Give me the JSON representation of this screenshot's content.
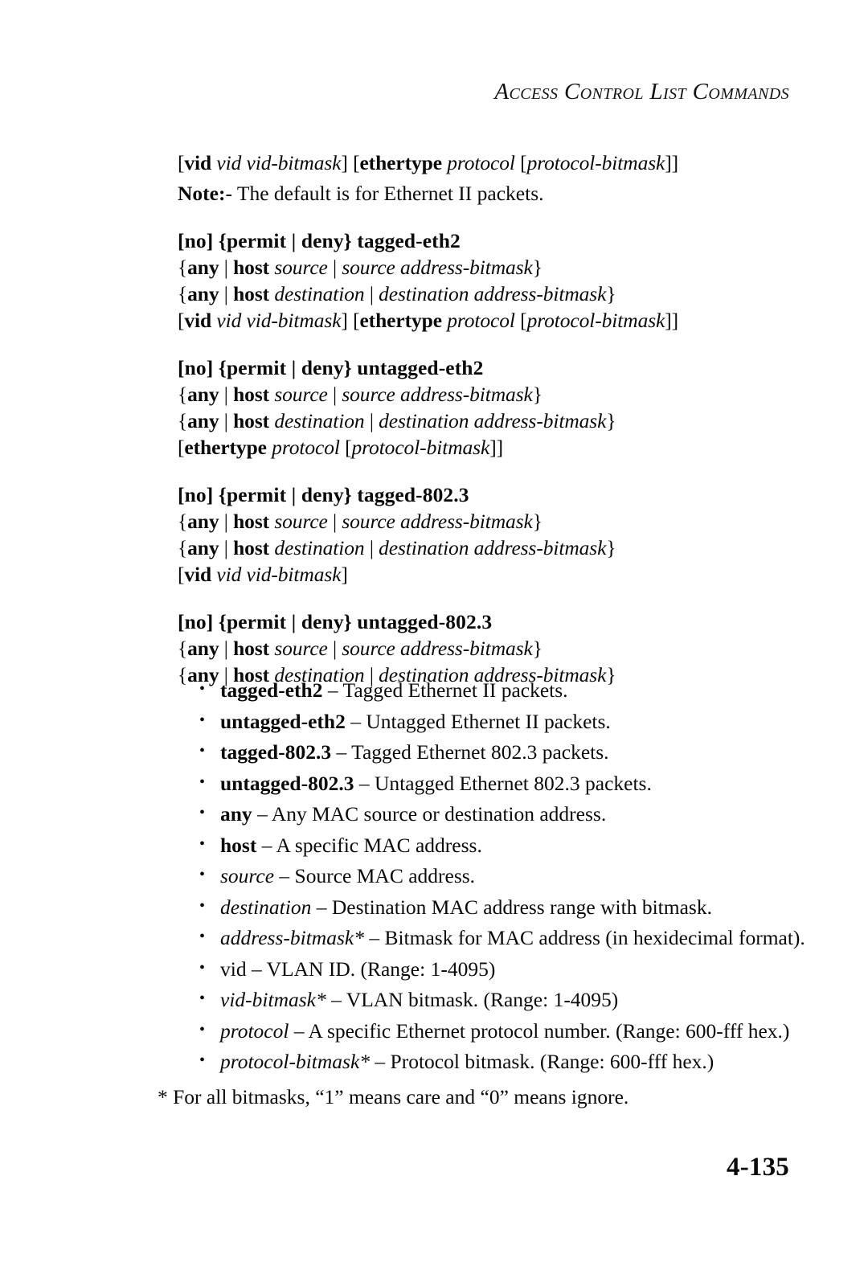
{
  "header": {
    "running_title": "Access Control List Commands"
  },
  "intro": {
    "syntax_line": [
      {
        "t": "[",
        "s": "r"
      },
      {
        "t": "vid",
        "s": "b"
      },
      {
        "t": " ",
        "s": "r"
      },
      {
        "t": "vid vid-bitmask",
        "s": "i"
      },
      {
        "t": "] [",
        "s": "r"
      },
      {
        "t": "ethertype",
        "s": "b"
      },
      {
        "t": " ",
        "s": "r"
      },
      {
        "t": "protocol",
        "s": "i"
      },
      {
        "t": " [",
        "s": "r"
      },
      {
        "t": "protocol-bitmask",
        "s": "i"
      },
      {
        "t": "]]",
        "s": "r"
      }
    ],
    "note_label": "Note:",
    "note_text": "- The default is for Ethernet II packets."
  },
  "syntax_blocks": [
    {
      "name": "tagged-eth2",
      "lines": [
        [
          {
            "t": "[no] {permit | deny} tagged-eth2",
            "s": "b"
          }
        ],
        [
          {
            "t": "{",
            "s": "r"
          },
          {
            "t": "any",
            "s": "b"
          },
          {
            "t": " | ",
            "s": "r"
          },
          {
            "t": "host",
            "s": "b"
          },
          {
            "t": " ",
            "s": "r"
          },
          {
            "t": "source",
            "s": "i"
          },
          {
            "t": " | ",
            "s": "r"
          },
          {
            "t": "source address-bitmask",
            "s": "i"
          },
          {
            "t": "}",
            "s": "r"
          }
        ],
        [
          {
            "t": "{",
            "s": "r"
          },
          {
            "t": "any",
            "s": "b"
          },
          {
            "t": " | ",
            "s": "r"
          },
          {
            "t": "host",
            "s": "b"
          },
          {
            "t": " ",
            "s": "r"
          },
          {
            "t": "destination",
            "s": "i"
          },
          {
            "t": " | ",
            "s": "r"
          },
          {
            "t": "destination address-bitmask",
            "s": "i"
          },
          {
            "t": "}",
            "s": "r"
          }
        ],
        [
          {
            "t": "[",
            "s": "r"
          },
          {
            "t": "vid",
            "s": "b"
          },
          {
            "t": " ",
            "s": "r"
          },
          {
            "t": "vid vid-bitmask",
            "s": "i"
          },
          {
            "t": "] [",
            "s": "r"
          },
          {
            "t": "ethertype",
            "s": "b"
          },
          {
            "t": " ",
            "s": "r"
          },
          {
            "t": "protocol",
            "s": "i"
          },
          {
            "t": " [",
            "s": "r"
          },
          {
            "t": "protocol-bitmask",
            "s": "i"
          },
          {
            "t": "]]",
            "s": "r"
          }
        ]
      ]
    },
    {
      "name": "untagged-eth2",
      "lines": [
        [
          {
            "t": "[no] {permit | deny} untagged-eth2",
            "s": "b"
          }
        ],
        [
          {
            "t": "{",
            "s": "r"
          },
          {
            "t": "any",
            "s": "b"
          },
          {
            "t": " | ",
            "s": "r"
          },
          {
            "t": "host",
            "s": "b"
          },
          {
            "t": " ",
            "s": "r"
          },
          {
            "t": "source",
            "s": "i"
          },
          {
            "t": " | ",
            "s": "r"
          },
          {
            "t": "source address-bitmask",
            "s": "i"
          },
          {
            "t": "}",
            "s": "r"
          }
        ],
        [
          {
            "t": "{",
            "s": "r"
          },
          {
            "t": "any",
            "s": "b"
          },
          {
            "t": " | ",
            "s": "r"
          },
          {
            "t": "host",
            "s": "b"
          },
          {
            "t": " ",
            "s": "r"
          },
          {
            "t": "destination",
            "s": "i"
          },
          {
            "t": " | ",
            "s": "r"
          },
          {
            "t": "destination address-bitmask",
            "s": "i"
          },
          {
            "t": "}",
            "s": "r"
          }
        ],
        [
          {
            "t": "[",
            "s": "r"
          },
          {
            "t": "ethertype",
            "s": "b"
          },
          {
            "t": " ",
            "s": "r"
          },
          {
            "t": "protocol",
            "s": "i"
          },
          {
            "t": " [",
            "s": "r"
          },
          {
            "t": "protocol-bitmask",
            "s": "i"
          },
          {
            "t": "]]",
            "s": "r"
          }
        ]
      ]
    },
    {
      "name": "tagged-802.3",
      "lines": [
        [
          {
            "t": "[no] {permit | deny} tagged-802.3",
            "s": "b"
          }
        ],
        [
          {
            "t": "{",
            "s": "r"
          },
          {
            "t": "any",
            "s": "b"
          },
          {
            "t": " | ",
            "s": "r"
          },
          {
            "t": "host",
            "s": "b"
          },
          {
            "t": " ",
            "s": "r"
          },
          {
            "t": "source",
            "s": "i"
          },
          {
            "t": " | ",
            "s": "r"
          },
          {
            "t": "source address-bitmask",
            "s": "i"
          },
          {
            "t": "}",
            "s": "r"
          }
        ],
        [
          {
            "t": "{",
            "s": "r"
          },
          {
            "t": "any",
            "s": "b"
          },
          {
            "t": " | ",
            "s": "r"
          },
          {
            "t": "host",
            "s": "b"
          },
          {
            "t": " ",
            "s": "r"
          },
          {
            "t": "destination",
            "s": "i"
          },
          {
            "t": " | ",
            "s": "r"
          },
          {
            "t": "destination address-bitmask",
            "s": "i"
          },
          {
            "t": "}",
            "s": "r"
          }
        ],
        [
          {
            "t": "[",
            "s": "r"
          },
          {
            "t": "vid",
            "s": "b"
          },
          {
            "t": " ",
            "s": "r"
          },
          {
            "t": "vid vid-bitmask",
            "s": "i"
          },
          {
            "t": "]",
            "s": "r"
          }
        ]
      ]
    },
    {
      "name": "untagged-802.3",
      "lines": [
        [
          {
            "t": "[no] {permit | deny} untagged-802.3",
            "s": "b"
          }
        ],
        [
          {
            "t": "{",
            "s": "r"
          },
          {
            "t": "any",
            "s": "b"
          },
          {
            "t": " | ",
            "s": "r"
          },
          {
            "t": "host",
            "s": "b"
          },
          {
            "t": " ",
            "s": "r"
          },
          {
            "t": "source",
            "s": "i"
          },
          {
            "t": " | ",
            "s": "r"
          },
          {
            "t": "source address-bitmask",
            "s": "i"
          },
          {
            "t": "}",
            "s": "r"
          }
        ],
        [
          {
            "t": "{",
            "s": "r"
          },
          {
            "t": "any",
            "s": "b"
          },
          {
            "t": " | ",
            "s": "r"
          },
          {
            "t": "host",
            "s": "b"
          },
          {
            "t": " ",
            "s": "r"
          },
          {
            "t": "destination",
            "s": "i"
          },
          {
            "t": " | ",
            "s": "r"
          },
          {
            "t": "destination address-bitmask",
            "s": "i"
          },
          {
            "t": "}",
            "s": "r"
          }
        ]
      ]
    }
  ],
  "bullets": [
    {
      "term": "tagged-eth2",
      "term_style": "b",
      "desc": " – Tagged Ethernet II packets."
    },
    {
      "term": "untagged-eth2",
      "term_style": "b",
      "desc": " – Untagged Ethernet II packets."
    },
    {
      "term": "tagged-802.3",
      "term_style": "b",
      "desc": " – Tagged Ethernet 802.3 packets."
    },
    {
      "term": "untagged-802.3",
      "term_style": "b",
      "desc": " – Untagged Ethernet 802.3 packets."
    },
    {
      "term": "any",
      "term_style": "b",
      "desc": " – Any MAC source or destination address."
    },
    {
      "term": "host",
      "term_style": "b",
      "desc": " – A specific MAC address."
    },
    {
      "term": "source",
      "term_style": "i",
      "desc": " – Source MAC address."
    },
    {
      "term": "destination",
      "term_style": "i",
      "desc": " – Destination MAC address range with bitmask."
    },
    {
      "term": "address-bitmask*",
      "term_style": "i",
      "desc": " – Bitmask for MAC address (in hexidecimal format)."
    },
    {
      "term": "vid",
      "term_style": "r",
      "desc": " – VLAN ID. (Range: 1-4095)"
    },
    {
      "term": "vid-bitmask*",
      "term_style": "i",
      "desc": " – VLAN bitmask. (Range: 1-4095)"
    },
    {
      "term": "protocol",
      "term_style": "i",
      "desc": " – A specific Ethernet protocol number. (Range: 600-fff hex.)"
    },
    {
      "term": "protocol-bitmask*",
      "term_style": "i",
      "desc": " – Protocol bitmask. (Range: 600-fff hex.)"
    }
  ],
  "footnote": "* For all bitmasks, “1” means care and “0” means ignore.",
  "folio": "4-135"
}
